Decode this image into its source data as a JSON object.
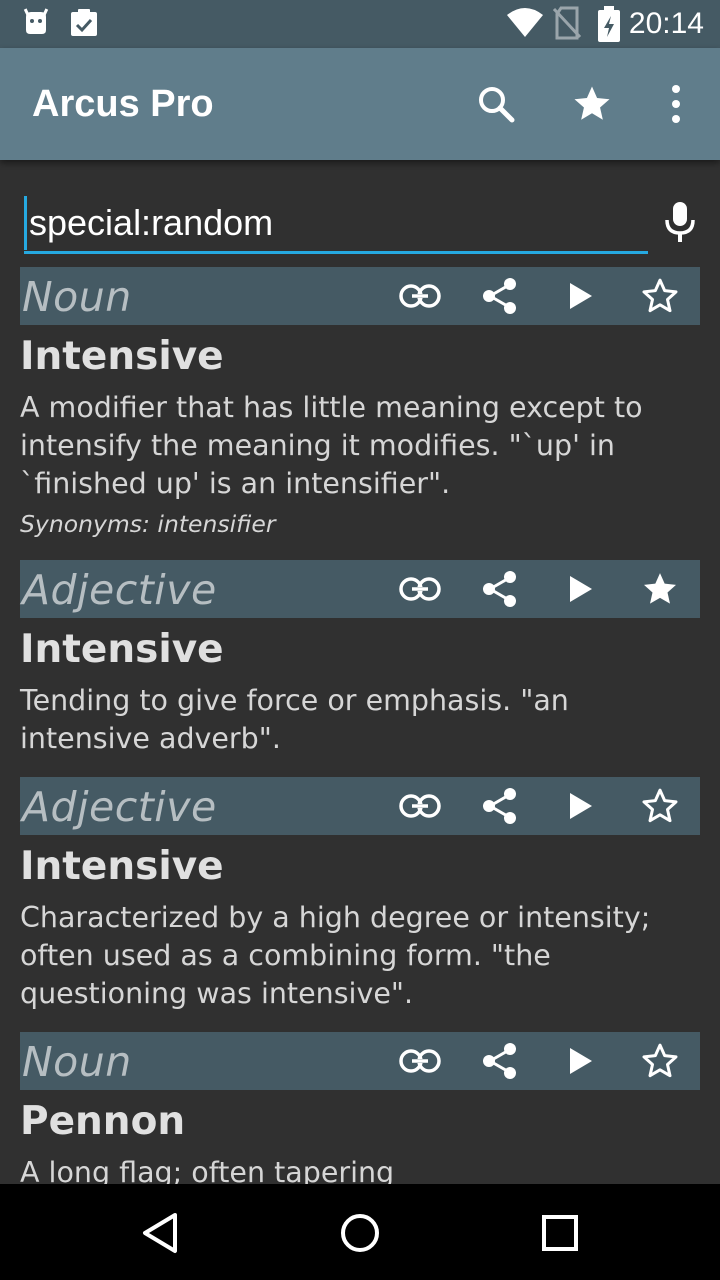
{
  "status_bar": {
    "time": "20:14",
    "left_icons": [
      "android-icon",
      "clipboard-check-icon"
    ],
    "right_icons": [
      "wifi-icon",
      "no-sim-icon",
      "battery-charging-icon"
    ]
  },
  "app_bar": {
    "title": "Arcus Pro",
    "actions": [
      "search-icon",
      "star-icon",
      "more-vert-icon"
    ]
  },
  "search": {
    "value": "special:random",
    "placeholder": ""
  },
  "entries": [
    {
      "part_of_speech": "Noun",
      "word": "Intensive",
      "definition": "A modifier that has little meaning except to intensify the meaning it modifies. \"`up' in `finished up' is an intensifier\".",
      "synonyms": "Synonyms: intensifier",
      "favorited": false
    },
    {
      "part_of_speech": "Adjective",
      "word": "Intensive",
      "definition": "Tending to give force or emphasis. \"an intensive adverb\".",
      "synonyms": "",
      "favorited": true
    },
    {
      "part_of_speech": "Adjective",
      "word": "Intensive",
      "definition": "Characterized by a high degree or intensity; often used as a combining form. \"the questioning was intensive\".",
      "synonyms": "",
      "favorited": false
    },
    {
      "part_of_speech": "Noun",
      "word": "Pennon",
      "definition": "A long flag; often tapering",
      "synonyms": "",
      "favorited": false
    }
  ],
  "colors": {
    "status_bar": "#455a64",
    "app_bar": "#607d8b",
    "background": "#303030",
    "entry_header": "#455a64",
    "accent": "#26a9e0"
  },
  "nav_bar": [
    "back-icon",
    "home-icon",
    "recents-icon"
  ]
}
